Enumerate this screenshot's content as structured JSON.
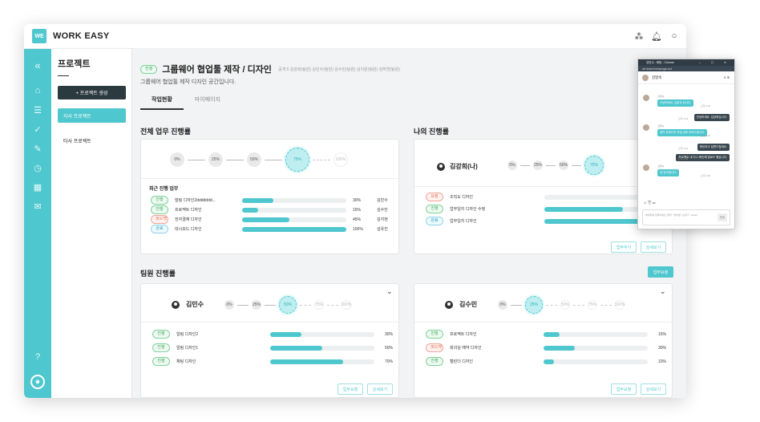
{
  "app": {
    "logo": "WE",
    "title": "WORK EASY"
  },
  "topbar_icons": [
    "share-icon",
    "bell-icon",
    "chat-icon"
  ],
  "rail_icons": [
    "collapse-icon",
    "home-icon",
    "document-icon",
    "check-circle-icon",
    "edit-doc-icon",
    "clock-icon",
    "calendar-icon",
    "mail-icon",
    "help-icon",
    "user-icon"
  ],
  "sidebar": {
    "title": "프로젝트",
    "create_label": "+ 프로젝트 생성",
    "items": [
      {
        "label": "자사 프로젝트"
      },
      {
        "label": "타사 프로젝트"
      }
    ]
  },
  "project": {
    "status": "진행",
    "title": "그룹웨어 협업툴 제작 / 디자인",
    "meta": "공개   5 김강희(팀원)  김민수(팀원)  김수민(팀원)  김지원(팀원)  김하연(팀원)",
    "desc": "그룹웨어 협업툴 제작 디자인 공간입니다."
  },
  "tabs": [
    {
      "label": "작업현황"
    },
    {
      "label": "마이페이지"
    }
  ],
  "overall": {
    "title": "전체 업무 진행률",
    "steps": [
      "0%",
      "25%",
      "50%",
      "75%",
      "100%"
    ],
    "current": 3,
    "recent_title": "최근 진행 업무",
    "rows": [
      {
        "status": "진행",
        "task": "말림 디자인2ddddddd...",
        "pct": 30,
        "pct_label": "30%",
        "owner": "김민수"
      },
      {
        "status": "진행",
        "task": "프로젝트 디자인",
        "pct": 15,
        "pct_label": "15%",
        "owner": "김수민"
      },
      {
        "status": "피드백",
        "task": "전자결재 디자인",
        "pct": 45,
        "pct_label": "45%",
        "owner": "김지현"
      },
      {
        "status": "완료",
        "task": "대시보드 디자인",
        "pct": 100,
        "pct_label": "100%",
        "owner": "김유진"
      }
    ]
  },
  "mine": {
    "title": "나의 진행률",
    "name": "김강희(나)",
    "steps": [
      "0%",
      "25%",
      "50%",
      "75%"
    ],
    "current": 3,
    "rows": [
      {
        "status": "요청",
        "task": "조직도 디자인",
        "pct": 0
      },
      {
        "status": "진행",
        "task": "업무일지 디자인 수정",
        "pct": 65
      },
      {
        "status": "완료",
        "task": "업무일지 디자인",
        "pct": 100
      }
    ],
    "buttons": [
      "업무추가",
      "상세보기"
    ]
  },
  "team": {
    "title": "팀원 진행률",
    "request_label": "업무요청",
    "members": [
      {
        "name": "김민수",
        "steps": [
          "0%",
          "25%",
          "50%",
          "75%",
          "100%"
        ],
        "current": 2,
        "rows": [
          {
            "status": "진행",
            "task": "알림 디자인2",
            "pct": 30,
            "pct_label": "30%"
          },
          {
            "status": "진행",
            "task": "알림 디자인1",
            "pct": 50,
            "pct_label": "50%"
          },
          {
            "status": "진행",
            "task": "채팅 디자인",
            "pct": 70,
            "pct_label": "70%"
          }
        ],
        "buttons": [
          "업무요청",
          "상세보기"
        ]
      },
      {
        "name": "김수민",
        "steps": [
          "0%",
          "25%",
          "50%",
          "75%",
          "100%"
        ],
        "current": 1,
        "rows": [
          {
            "status": "진행",
            "task": "프로젝트 디자인",
            "pct": 15,
            "pct_label": "15%"
          },
          {
            "status": "피드백",
            "task": "회의실 예약 디자인",
            "pct": 30,
            "pct_label": "30%"
          },
          {
            "status": "진행",
            "task": "캘린더 디자인",
            "pct": 10,
            "pct_label": "10%"
          }
        ],
        "buttons": [
          "업무요청",
          "상세보기"
        ]
      }
    ]
  },
  "chat": {
    "window_title": "김민수 - 채팅 - Chrome",
    "url": "we.team/messenger.act",
    "user": "김말숙",
    "messages": [
      {
        "side": "in",
        "sender": "김말숙",
        "text": "안녕하세요. 김말숙 입니다.",
        "time": "오후 3:22"
      },
      {
        "side": "out",
        "text": "안녕하세요. 김강희입니다.",
        "time": "오후 3:22"
      },
      {
        "side": "in",
        "sender": "김말숙",
        "text": "제가 요청드린 작업 검토 부탁드립니다.",
        "time": "오후 3:22"
      },
      {
        "side": "out",
        "text": "확인하고 답변드릴게요.",
        "time": "오후 3:22"
      },
      {
        "side": "out",
        "text": "프로젝트 내 다시 확인해 업로드 했습니다.",
        "time": "오후 3:22"
      },
      {
        "side": "in",
        "sender": "김말숙",
        "text": "네 감사합니다.",
        "time": "오후 3:22"
      }
    ],
    "input_placeholder": "메세지를 입력하세요 (엔터 : 줄바꿈 / 보내기 : Enter)",
    "send_label": "전송"
  }
}
